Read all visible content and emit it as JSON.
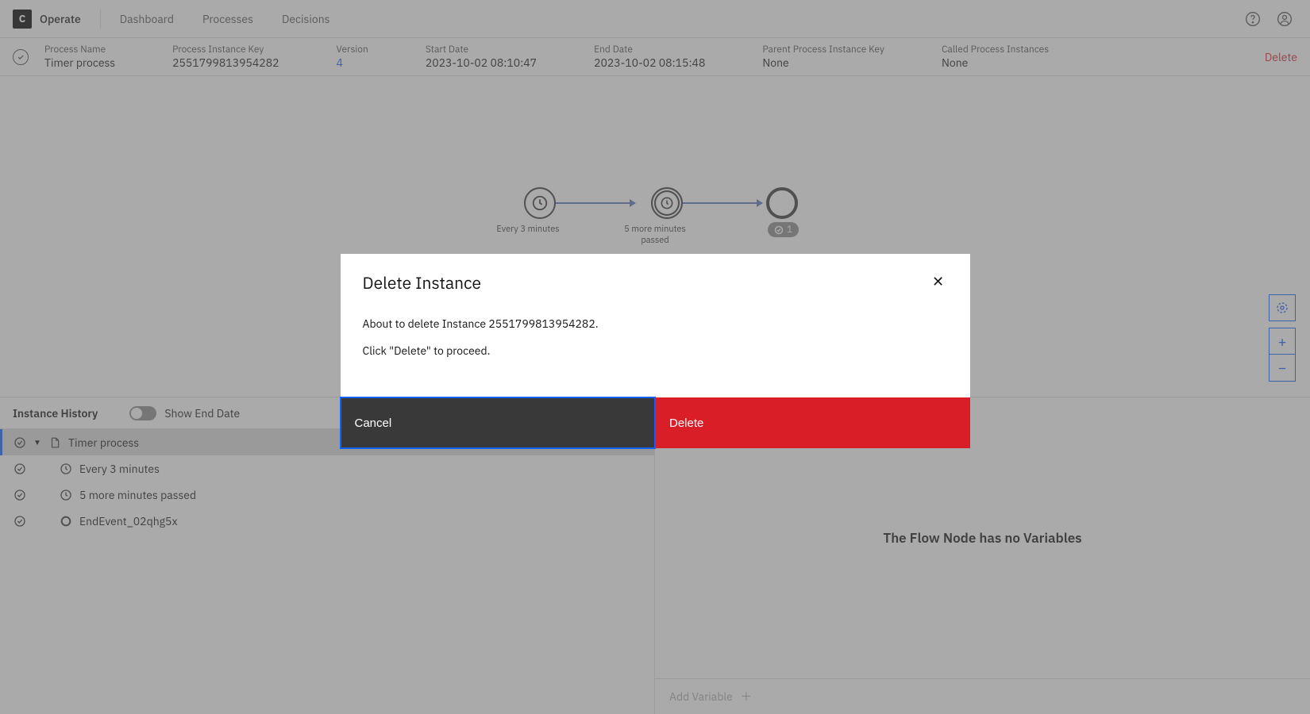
{
  "nav": {
    "app": "Operate",
    "links": [
      "Dashboard",
      "Processes",
      "Decisions"
    ]
  },
  "instance": {
    "fields": [
      {
        "label": "Process Name",
        "value": "Timer process"
      },
      {
        "label": "Process Instance Key",
        "value": "2551799813954282"
      },
      {
        "label": "Version",
        "value": "4",
        "link": true
      },
      {
        "label": "Start Date",
        "value": "2023-10-02 08:10:47"
      },
      {
        "label": "End Date",
        "value": "2023-10-02 08:15:48"
      },
      {
        "label": "Parent Process Instance Key",
        "value": "None"
      },
      {
        "label": "Called Process Instances",
        "value": "None"
      }
    ],
    "delete_label": "Delete"
  },
  "diagram": {
    "nodes": [
      {
        "label": "Every 3 minutes",
        "type": "timer"
      },
      {
        "label": "5 more minutes passed",
        "type": "timer"
      },
      {
        "label": "",
        "type": "end",
        "badge": "1"
      }
    ]
  },
  "history": {
    "title": "Instance History",
    "toggle_label": "Show End Date",
    "rows": [
      {
        "label": "Timer process",
        "icon": "doc",
        "selected": true,
        "indent": 0,
        "caret": true
      },
      {
        "label": "Every 3 minutes",
        "icon": "clock",
        "indent": 1
      },
      {
        "label": "5 more minutes passed",
        "icon": "clock",
        "indent": 1
      },
      {
        "label": "EndEvent_02qhg5x",
        "icon": "end",
        "indent": 1
      }
    ]
  },
  "variables": {
    "empty": "The Flow Node has no Variables",
    "add_label": "Add Variable"
  },
  "modal": {
    "title": "Delete Instance",
    "line1": "About to delete Instance 2551799813954282.",
    "line2": "Click \"Delete\" to proceed.",
    "cancel": "Cancel",
    "delete": "Delete"
  }
}
